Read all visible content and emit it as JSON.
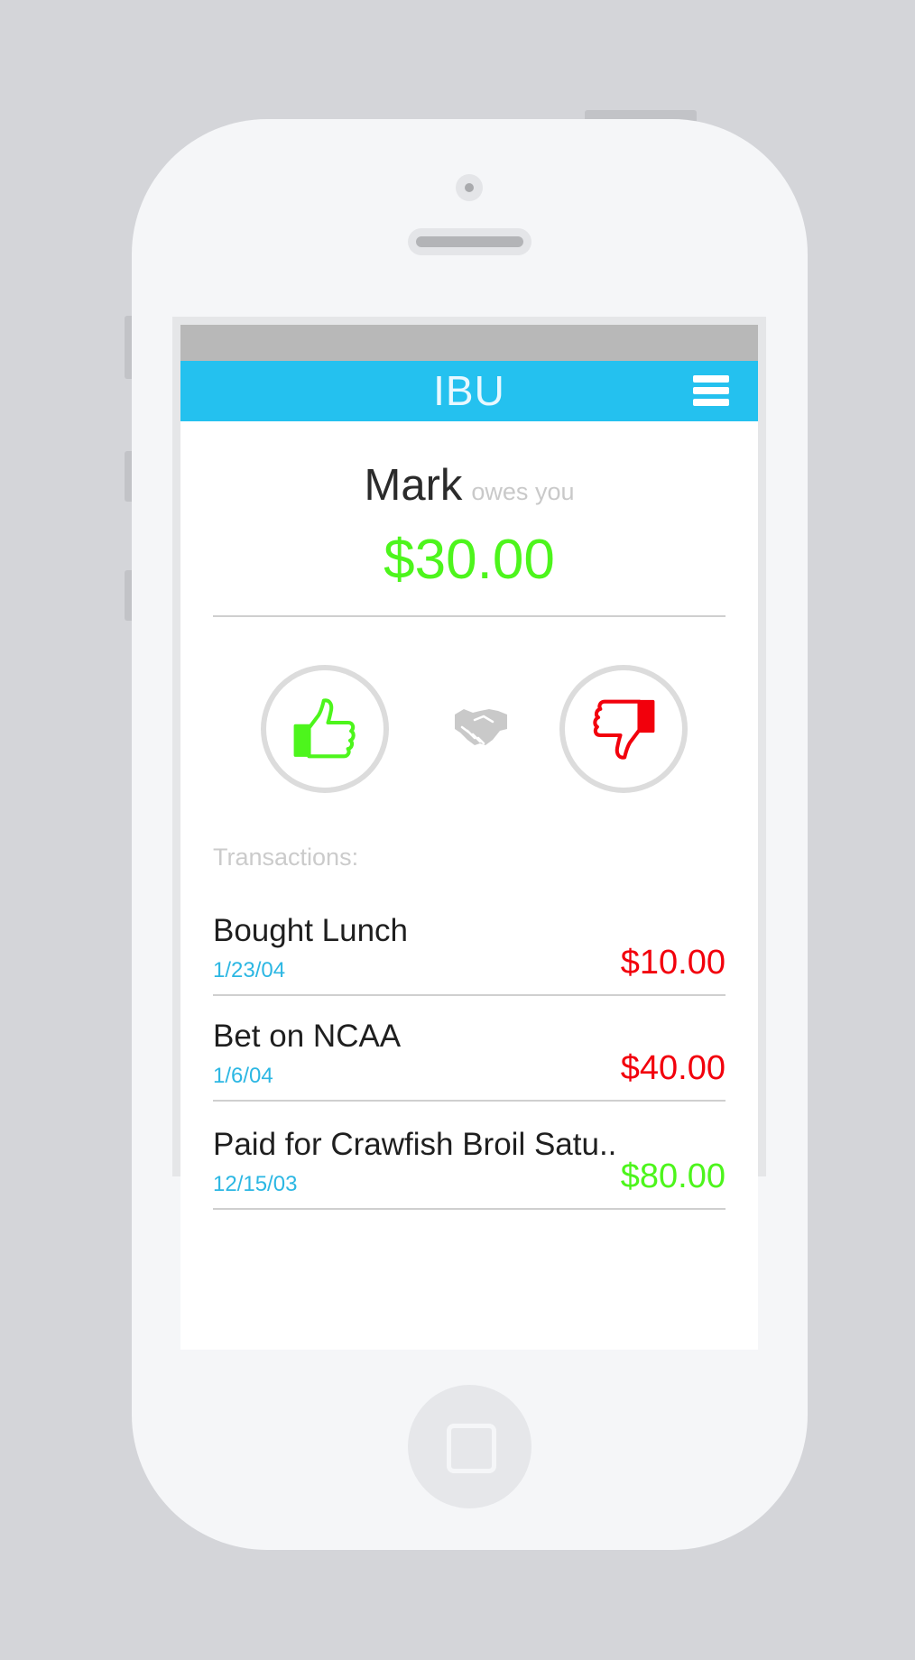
{
  "colors": {
    "accent": "#24c1ef",
    "positive": "#4df51c",
    "negative": "#f2000c",
    "date": "#2cb7e3"
  },
  "app": {
    "title": "IBU",
    "menu_icon": "hamburger-menu-icon"
  },
  "summary": {
    "name": "Mark",
    "status": "owes you",
    "amount": "$30.00"
  },
  "actions": {
    "approve_icon": "thumbs-up-icon",
    "settle_icon": "handshake-icon",
    "reject_icon": "thumbs-down-icon"
  },
  "transactions": {
    "header": "Transactions:",
    "items": [
      {
        "title": "Bought Lunch",
        "date": "1/23/04",
        "amount": "$10.00",
        "direction": "negative"
      },
      {
        "title": "Bet on NCAA",
        "date": "1/6/04",
        "amount": "$40.00",
        "direction": "negative"
      },
      {
        "title": "Paid for Crawfish Broil Satu..",
        "date": "12/15/03",
        "amount": "$80.00",
        "direction": "positive"
      }
    ]
  }
}
